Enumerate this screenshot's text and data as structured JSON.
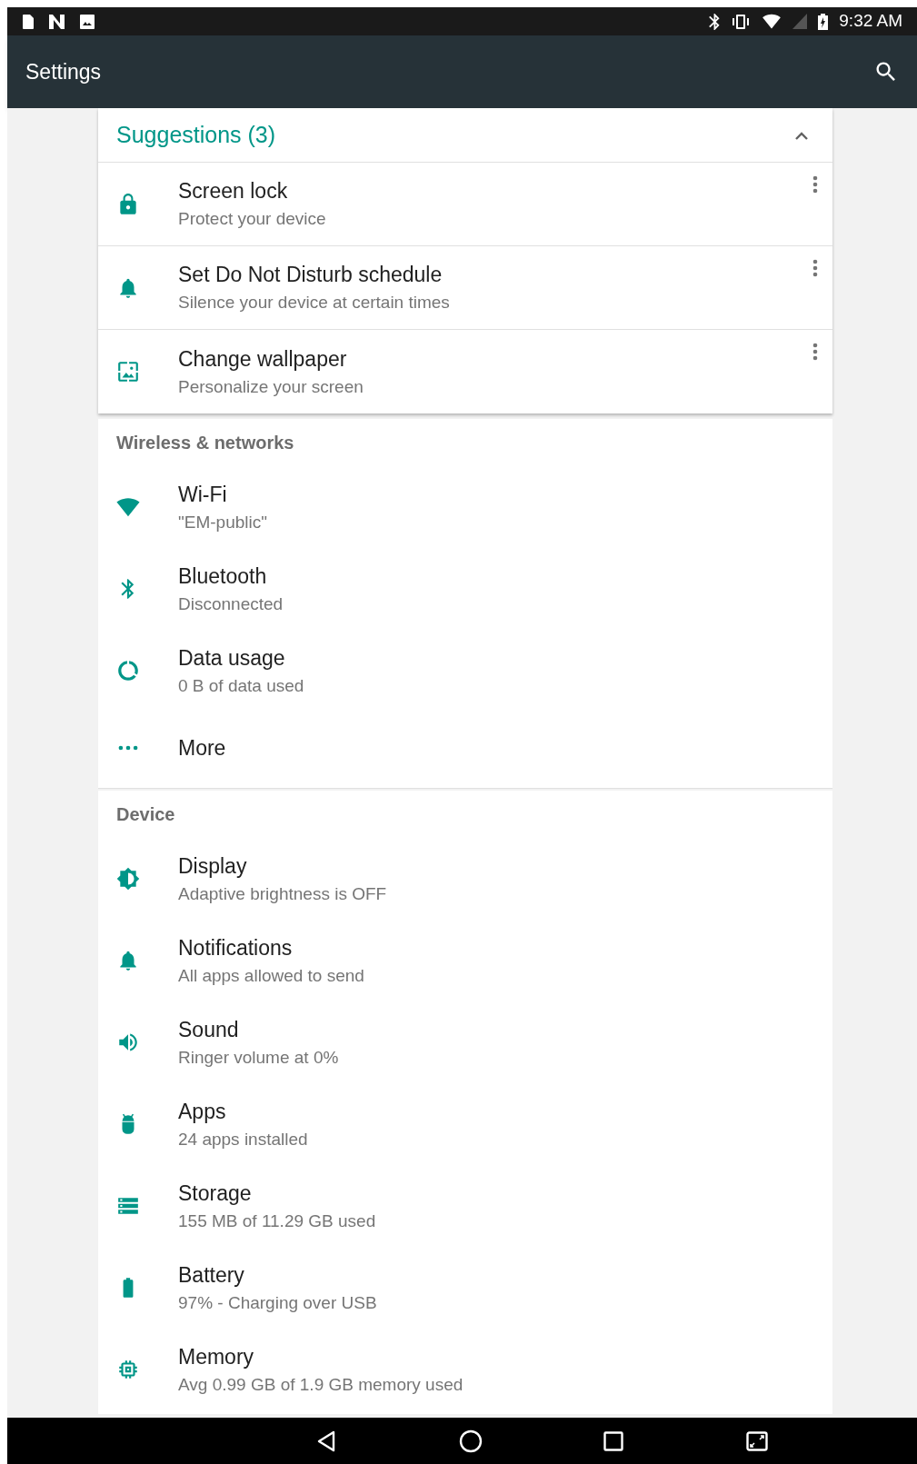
{
  "status_bar": {
    "time": "9:32 AM"
  },
  "app_bar": {
    "title": "Settings"
  },
  "suggestions": {
    "title": "Suggestions (3)",
    "expanded": true,
    "items": [
      {
        "title": "Screen lock",
        "summary": "Protect your device"
      },
      {
        "title": "Set Do Not Disturb schedule",
        "summary": "Silence your device at certain times"
      },
      {
        "title": "Change wallpaper",
        "summary": "Personalize your screen"
      }
    ]
  },
  "sections": [
    {
      "title": "Wireless & networks",
      "items": [
        {
          "title": "Wi-Fi",
          "summary": "\"EM-public\""
        },
        {
          "title": "Bluetooth",
          "summary": "Disconnected"
        },
        {
          "title": "Data usage",
          "summary": "0 B of data used"
        },
        {
          "title": "More"
        }
      ]
    },
    {
      "title": "Device",
      "items": [
        {
          "title": "Display",
          "summary": "Adaptive brightness is OFF"
        },
        {
          "title": "Notifications",
          "summary": "All apps allowed to send"
        },
        {
          "title": "Sound",
          "summary": "Ringer volume at 0%"
        },
        {
          "title": "Apps",
          "summary": "24 apps installed"
        },
        {
          "title": "Storage",
          "summary": "155 MB of 11.29 GB used"
        },
        {
          "title": "Battery",
          "summary": "97% - Charging over USB"
        },
        {
          "title": "Memory",
          "summary": "Avg 0.99 GB of 1.9 GB memory used"
        }
      ]
    }
  ]
}
